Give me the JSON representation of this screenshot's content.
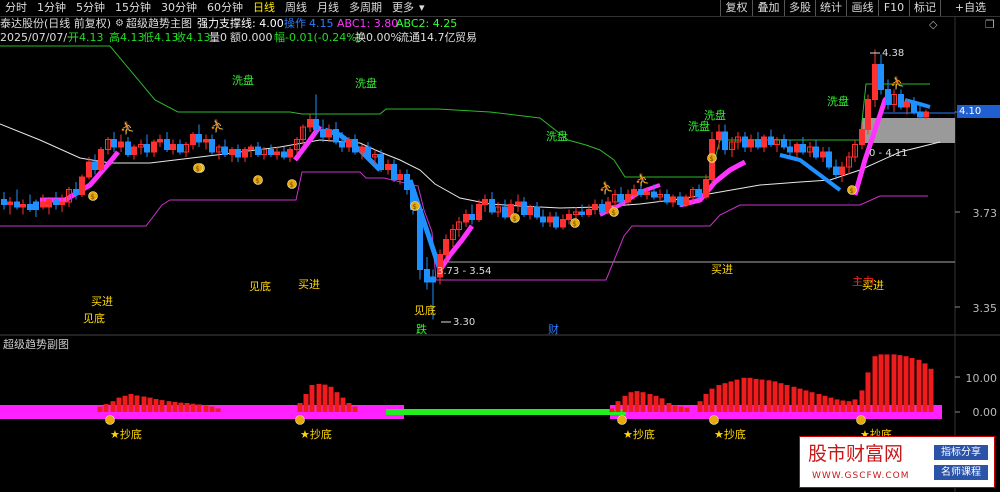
{
  "tabs": [
    "分时",
    "1分钟",
    "5分钟",
    "15分钟",
    "30分钟",
    "60分钟",
    "日线",
    "周线",
    "月线",
    "多周期",
    "更多"
  ],
  "active_tab": 6,
  "more_arrow": "▾",
  "right_buttons": [
    "复权",
    "叠加",
    "多股",
    "统计",
    "画线",
    "F10",
    "标记",
    "+自选"
  ],
  "win_buttons": {
    "diamond": "◇",
    "restore": "❐"
  },
  "header": {
    "stock": "泰达股份(日线 前复权)",
    "indicator_icon": "gear-icon",
    "indicator_name": "超级趋势主图",
    "support_label": "强力支撑线: 4.00",
    "op_label": "操作",
    "op_value": "4.15",
    "abc1": "ABC1: 3.80",
    "abc2": "ABC2: 4.25"
  },
  "quote": {
    "date": "2025/07/07/一",
    "open": "开4.13",
    "high": "高4.13",
    "low": "低4.13",
    "close": "收4.13",
    "volume": "量0",
    "amount": "额0.000",
    "change": "幅-0.01(-0.24%)",
    "turnover": "换0.00%",
    "float": "流通14.7亿",
    "trade": "贸易"
  },
  "price_axis": {
    "labels": [
      "4.10",
      "3.73",
      "3.35"
    ],
    "current": "4.10"
  },
  "main_annotations": {
    "wash": "洗盘",
    "buy": "买进",
    "bottom": "见底",
    "fall": "跌",
    "finance": "财",
    "main_force": "主力",
    "high_marker": "4.38",
    "low_marker": "3.30",
    "range_label": "3.73 - 3.54",
    "range_label2": "0 - 4.11"
  },
  "sub_panel": {
    "title": "超级趋势副图",
    "axis_labels": [
      "10.00",
      "0.00"
    ],
    "signal": "★抄底"
  },
  "watermark": {
    "main_text": "股市财富网",
    "url": "WWW.GSCFW.COM",
    "tag1": "指标分享",
    "tag2": "名师课程"
  },
  "colors": {
    "up": "#ff3030",
    "down": "#1e90ff",
    "trend_band": "#ff33ff",
    "green_line": "#2db82d",
    "magenta_line": "#cc33cc",
    "white_line": "#e8e8e8",
    "hist_red": "#ee1c1c",
    "hist_green": "#22ee22",
    "hist_magenta": "#ff22ff",
    "tab_active": "#ffe800"
  }
}
